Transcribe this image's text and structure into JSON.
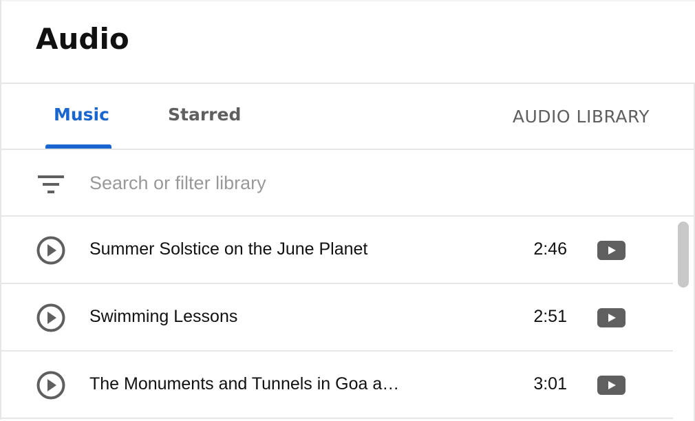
{
  "header": {
    "title": "Audio"
  },
  "tabs": [
    {
      "label": "Music",
      "active": true
    },
    {
      "label": "Starred",
      "active": false
    }
  ],
  "audio_library_link": "AUDIO LIBRARY",
  "search": {
    "placeholder": "Search or filter library",
    "value": "",
    "icon": "filter-icon"
  },
  "tracks": [
    {
      "title": "Summer Solstice on the June Planet",
      "duration": "2:46"
    },
    {
      "title": "Swimming Lessons",
      "duration": "2:51"
    },
    {
      "title": "The Monuments and Tunnels in Goa a…",
      "duration": "3:01"
    }
  ],
  "colors": {
    "accent": "#1a66d1",
    "icon": "#5f5f5f",
    "divider": "#e6e6e6"
  }
}
